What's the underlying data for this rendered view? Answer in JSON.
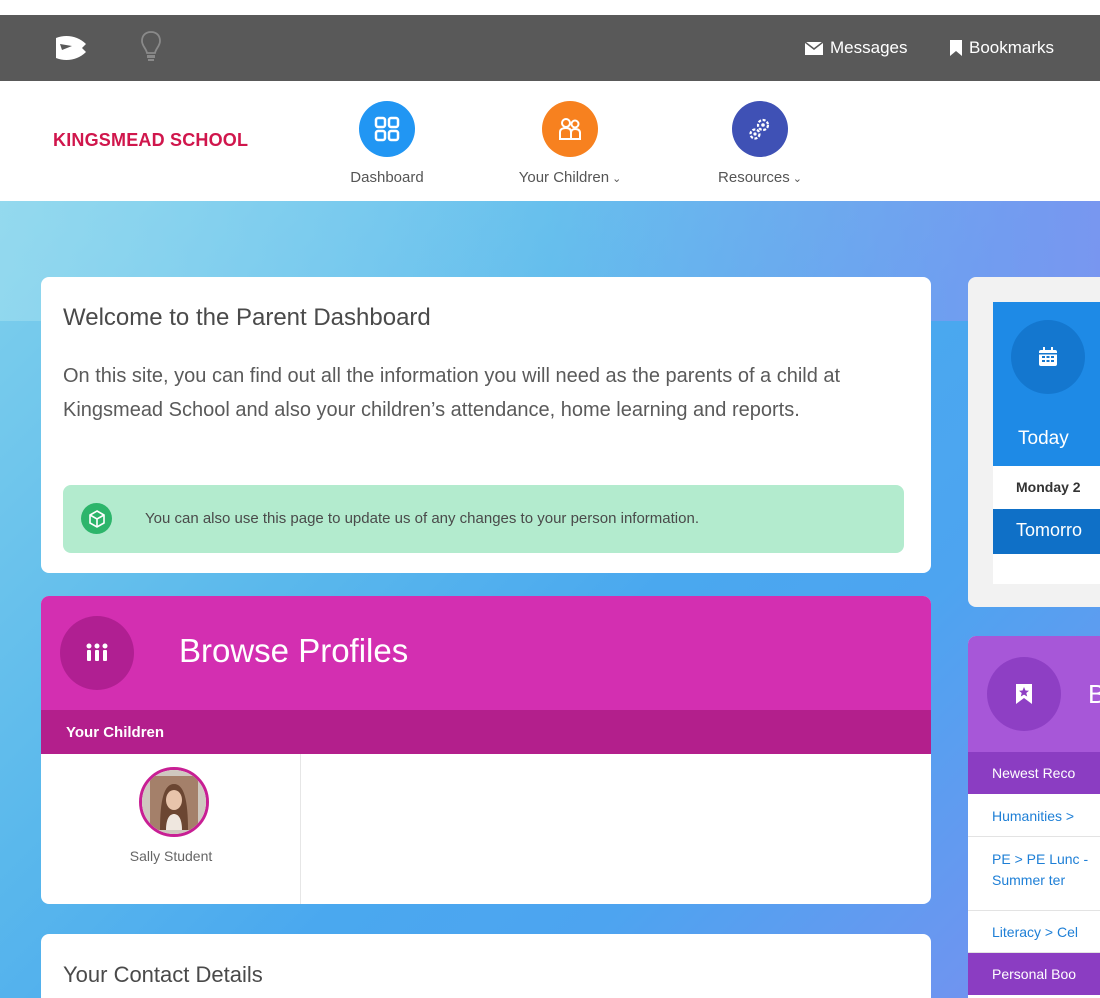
{
  "topbar": {
    "messages_label": "Messages",
    "bookmarks_label": "Bookmarks"
  },
  "header": {
    "school_name": "KINGSMEAD SCHOOL",
    "nav": {
      "dashboard": "Dashboard",
      "children": "Your Children",
      "resources": "Resources"
    }
  },
  "welcome": {
    "title": "Welcome to the Parent Dashboard",
    "text": "On this site, you can find out all the information you will need as the parents of a child at Kingsmead School and also your children’s attendance, home learning and reports.",
    "notice": "You can also use this page to update us of any changes to your person information."
  },
  "browse": {
    "title": "Browse Profiles",
    "section": "Your Children",
    "children": [
      {
        "name": "Sally Student"
      }
    ]
  },
  "contact": {
    "title": "Your Contact Details"
  },
  "calendar": {
    "today": "Today",
    "date": "Monday 2",
    "tomorrow": "Tomorro"
  },
  "bookmarks": {
    "title": "Bo",
    "newest": "Newest Reco",
    "links": [
      "Humanities >",
      "PE > PE Lunc - Summer ter",
      "Literacy > Cel"
    ],
    "personal": "Personal Boo"
  },
  "colors": {
    "topbar": "#595959",
    "school_name": "#d0164c",
    "dashboard": "#2196f3",
    "children": "#f7811f",
    "resources": "#3f51b5",
    "browse": "#d32fb1",
    "calendar": "#1e8ae6",
    "bookmarks": "#a757d8",
    "notice": "#b3ebce"
  }
}
